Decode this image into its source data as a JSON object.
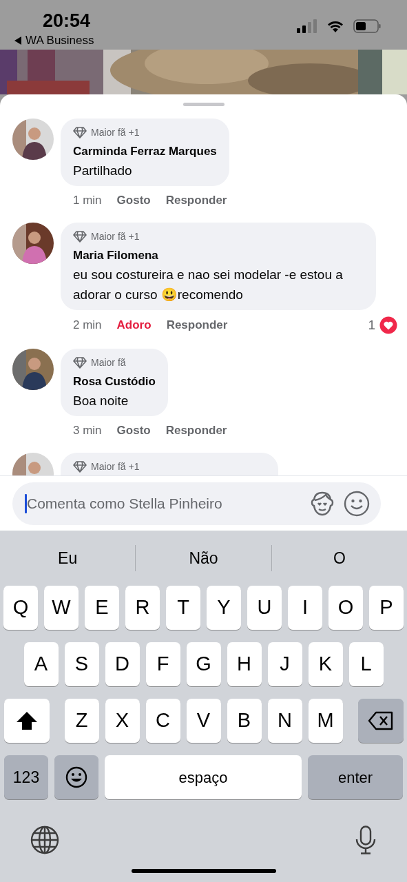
{
  "status_bar": {
    "time": "20:54",
    "back_label": "WA Business"
  },
  "comments": [
    {
      "badge": "Maior fã +1",
      "author": "Carminda Ferraz Marques",
      "text": "Partilhado",
      "time": "1 min",
      "reaction": {
        "label": "Gosto",
        "selected": false
      },
      "reply": "Responder"
    },
    {
      "badge": "Maior fã +1",
      "author": "Maria Filomena",
      "text": "eu sou costureira e nao sei modelar -e estou a adorar o curso 😃recomendo",
      "time": "2 min",
      "reaction": {
        "label": "Adoro",
        "selected": true
      },
      "reply": "Responder",
      "reaction_count": "1"
    },
    {
      "badge": "Maior fã",
      "author": "Rosa Custódio",
      "text": "Boa noite",
      "time": "3 min",
      "reaction": {
        "label": "Gosto",
        "selected": false
      },
      "reply": "Responder"
    },
    {
      "badge": "Maior fã +1"
    }
  ],
  "composer": {
    "placeholder": "Comenta como Stella Pinheiro",
    "focused": true
  },
  "keyboard": {
    "suggestions": [
      "Eu",
      "Não",
      "O"
    ],
    "rows": [
      [
        "Q",
        "W",
        "E",
        "R",
        "T",
        "Y",
        "U",
        "I",
        "O",
        "P"
      ],
      [
        "A",
        "S",
        "D",
        "F",
        "G",
        "H",
        "J",
        "K",
        "L"
      ],
      [
        "Z",
        "X",
        "C",
        "V",
        "B",
        "N",
        "M"
      ]
    ],
    "numbers_key": "123",
    "space_key": "espaço",
    "enter_key": "enter"
  }
}
